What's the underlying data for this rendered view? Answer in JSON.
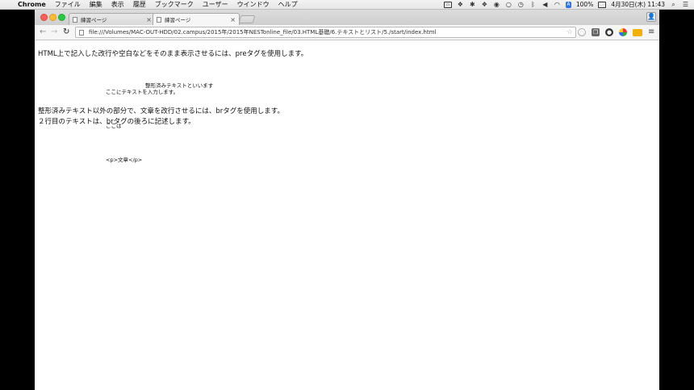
{
  "menubar": {
    "app": "Chrome",
    "items": [
      "ファイル",
      "編集",
      "表示",
      "履歴",
      "ブックマーク",
      "ユーザー",
      "ウインドウ",
      "ヘルプ"
    ],
    "status": {
      "input": "A",
      "battery": "100%",
      "datetime": "4月30日(木) 11:43"
    }
  },
  "tabs": [
    {
      "title": "練習ページ",
      "close": "×"
    },
    {
      "title": "練習ページ",
      "close": "×"
    }
  ],
  "toolbar": {
    "url": "file:///Volumes/MAC-OUT-HDD/02.campus/2015年/2015年NESTonline_file/03.HTML基礎/6.テキストとリスト/5./start/index.html"
  },
  "content": {
    "para1": "HTML上で記入した改行や空白などをそのまま表示させるには、preタグを使用します。",
    "pre_lines": [
      "ここにテキストを入力します。",
      "ここは",
      "<p>文章</p>"
    ],
    "pre_right": "整形済みテキストといいます",
    "para2": "整形済みテキスト以外の部分で、文章を改行させるには、brタグを使用します。",
    "para3": "２行目のテキストは、brタグの後ろに記述します。"
  },
  "colors": {
    "close": "#fc5f57",
    "minimize": "#fdbc2e",
    "zoom": "#28c840"
  }
}
